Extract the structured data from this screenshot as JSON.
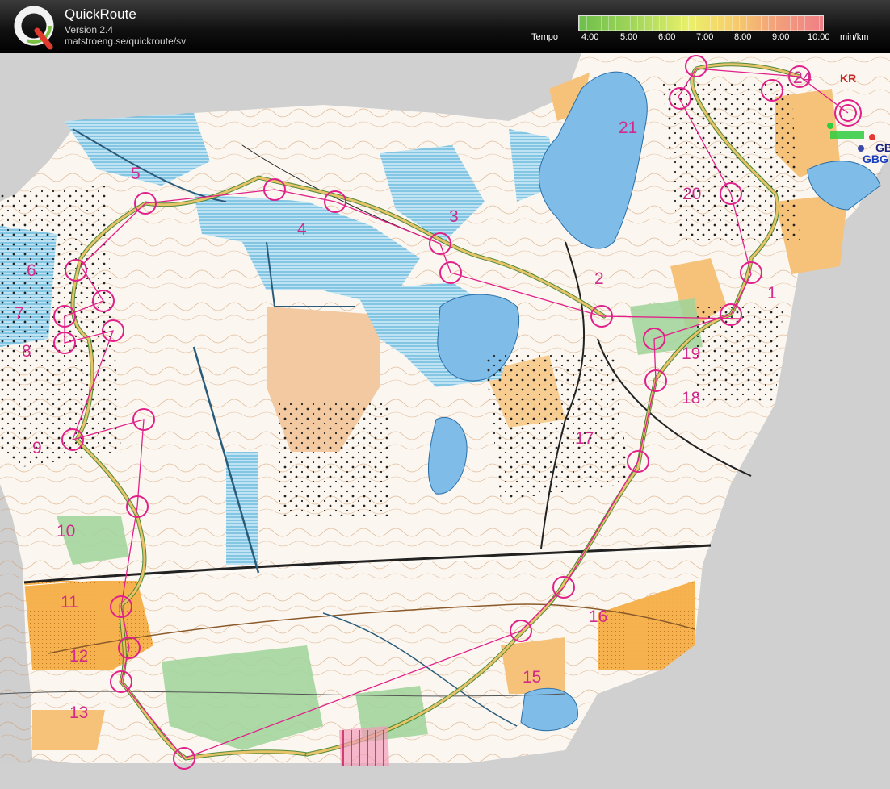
{
  "app": {
    "title": "QuickRoute",
    "version": "Version 2.4",
    "url": "matstroeng.se/quickroute/sv"
  },
  "tempo": {
    "label": "Tempo",
    "ticks": [
      "4:00",
      "5:00",
      "6:00",
      "7:00",
      "8:00",
      "9:00",
      "10:00"
    ],
    "unit": "min/km",
    "colors": [
      "#6cbf4b",
      "#a9d95c",
      "#eaf06a",
      "#f6d06a",
      "#f3a27a",
      "#ef7f86"
    ]
  },
  "map": {
    "controls": [
      {
        "label": "1"
      },
      {
        "label": "2"
      },
      {
        "label": "3"
      },
      {
        "label": "4"
      },
      {
        "label": "5"
      },
      {
        "label": "6"
      },
      {
        "label": "7"
      },
      {
        "label": "8"
      },
      {
        "label": "9"
      },
      {
        "label": "10"
      },
      {
        "label": "11"
      },
      {
        "label": "12"
      },
      {
        "label": "13"
      },
      {
        "label": "15"
      },
      {
        "label": "16"
      },
      {
        "label": "17"
      },
      {
        "label": "18"
      },
      {
        "label": "19"
      },
      {
        "label": "20"
      },
      {
        "label": "21"
      },
      {
        "label": "24"
      }
    ],
    "legend_tags": [
      "KR",
      "GB",
      "GBG"
    ],
    "colors": {
      "course": "#e0218a",
      "water": "#7fbce8",
      "marsh": "#4fb6e0",
      "open": "#f5b14e",
      "forest": "#ffffff",
      "route_fast": "#5aa33a",
      "route_slow": "#e9c36a"
    }
  }
}
